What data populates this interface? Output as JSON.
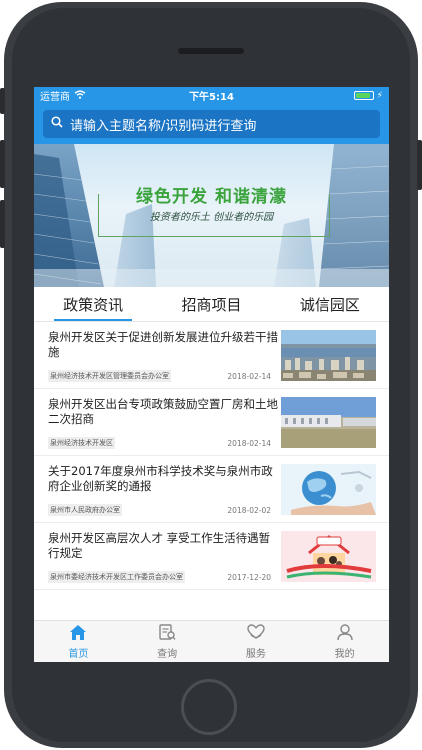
{
  "status_bar": {
    "carrier": "运营商",
    "time": "下午5:14",
    "battery_level": 0.9,
    "battery_color": "#5bd65b"
  },
  "search": {
    "placeholder": "请输入主题名称/识别码进行查询",
    "icon": "search-icon"
  },
  "banner": {
    "title": "绿色开发  和谐清濛",
    "subtitle": "投资者的乐土   创业者的乐园"
  },
  "tabs": [
    {
      "label": "政策资讯",
      "active": true
    },
    {
      "label": "招商项目",
      "active": false
    },
    {
      "label": "诚信园区",
      "active": false
    }
  ],
  "news": [
    {
      "title": "泉州开发区关于促进创新发展进位升级若干措施",
      "source": "泉州经济技术开发区管理委员会办公室",
      "date": "2018-02-14",
      "thumb": "city-aerial"
    },
    {
      "title": "泉州开发区出台专项政策鼓励空置厂房和土地二次招商",
      "source": "泉州经济技术开发区",
      "date": "2018-02-14",
      "thumb": "factory"
    },
    {
      "title": "关于2017年度泉州市科学技术奖与泉州市政府企业创新奖的通报",
      "source": "泉州市人民政府办公室",
      "date": "2018-02-02",
      "thumb": "globe-hand"
    },
    {
      "title": "泉州开发区高层次人才 享受工作生活待遇暂行规定",
      "source": "泉州市委经济技术开发区工作委员会办公室",
      "date": "2017-12-20",
      "thumb": "family-house"
    }
  ],
  "bottom_nav": [
    {
      "label": "首页",
      "icon": "home-icon",
      "active": true
    },
    {
      "label": "查询",
      "icon": "query-icon",
      "active": false
    },
    {
      "label": "服务",
      "icon": "service-icon",
      "active": false
    },
    {
      "label": "我的",
      "icon": "profile-icon",
      "active": false
    }
  ],
  "colors": {
    "accent": "#2796e6",
    "search_field": "#1b74c4",
    "banner_title": "#3aa33c"
  }
}
